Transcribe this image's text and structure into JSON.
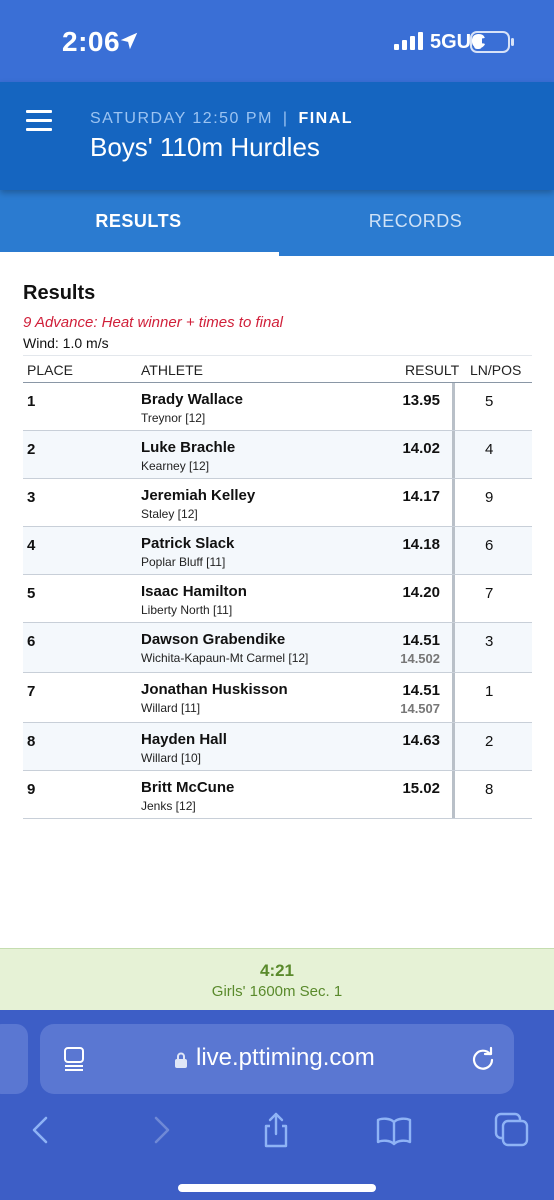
{
  "status_bar": {
    "time": "2:06",
    "network": "5GUC",
    "icons": [
      "location-arrow-icon",
      "signal-icon",
      "battery-icon"
    ]
  },
  "header": {
    "day_time": "SATURDAY 12:50 PM",
    "separator": "|",
    "status": "FINAL",
    "title": "Boys' 110m Hurdles",
    "menu_icon": "hamburger-menu-icon"
  },
  "tabs": [
    {
      "label": "RESULTS",
      "active": true
    },
    {
      "label": "RECORDS",
      "active": false
    }
  ],
  "results": {
    "heading": "Results",
    "advance_note": "9 Advance: Heat winner + times to final",
    "wind": "Wind: 1.0 m/s",
    "columns": {
      "place": "PLACE",
      "athlete": "ATHLETE",
      "result": "RESULT",
      "lane": "LN/POS"
    },
    "rows": [
      {
        "place": "1",
        "name": "Brady Wallace",
        "team": "Treynor [12]",
        "result": "13.95",
        "sub": "",
        "lane": "5"
      },
      {
        "place": "2",
        "name": "Luke Brachle",
        "team": "Kearney [12]",
        "result": "14.02",
        "sub": "",
        "lane": "4"
      },
      {
        "place": "3",
        "name": "Jeremiah Kelley",
        "team": "Staley [12]",
        "result": "14.17",
        "sub": "",
        "lane": "9"
      },
      {
        "place": "4",
        "name": "Patrick Slack",
        "team": "Poplar Bluff [11]",
        "result": "14.18",
        "sub": "",
        "lane": "6"
      },
      {
        "place": "5",
        "name": "Isaac Hamilton",
        "team": "Liberty North [11]",
        "result": "14.20",
        "sub": "",
        "lane": "7"
      },
      {
        "place": "6",
        "name": "Dawson Grabendike",
        "team": "Wichita-Kapaun-Mt Carmel [12]",
        "result": "14.51",
        "sub": "14.502",
        "lane": "3"
      },
      {
        "place": "7",
        "name": "Jonathan Huskisson",
        "team": "Willard [11]",
        "result": "14.51",
        "sub": "14.507",
        "lane": "1"
      },
      {
        "place": "8",
        "name": "Hayden Hall",
        "team": "Willard [10]",
        "result": "14.63",
        "sub": "",
        "lane": "2"
      },
      {
        "place": "9",
        "name": "Britt McCune",
        "team": "Jenks [12]",
        "result": "15.02",
        "sub": "",
        "lane": "8"
      }
    ]
  },
  "up_next": {
    "time": "4:21",
    "event": "Girls' 1600m Sec. 1"
  },
  "browser": {
    "url": "live.pttiming.com",
    "toolbar_icons": [
      "back-arrow-icon",
      "forward-arrow-icon",
      "share-icon",
      "bookmarks-icon",
      "tabs-icon"
    ]
  }
}
